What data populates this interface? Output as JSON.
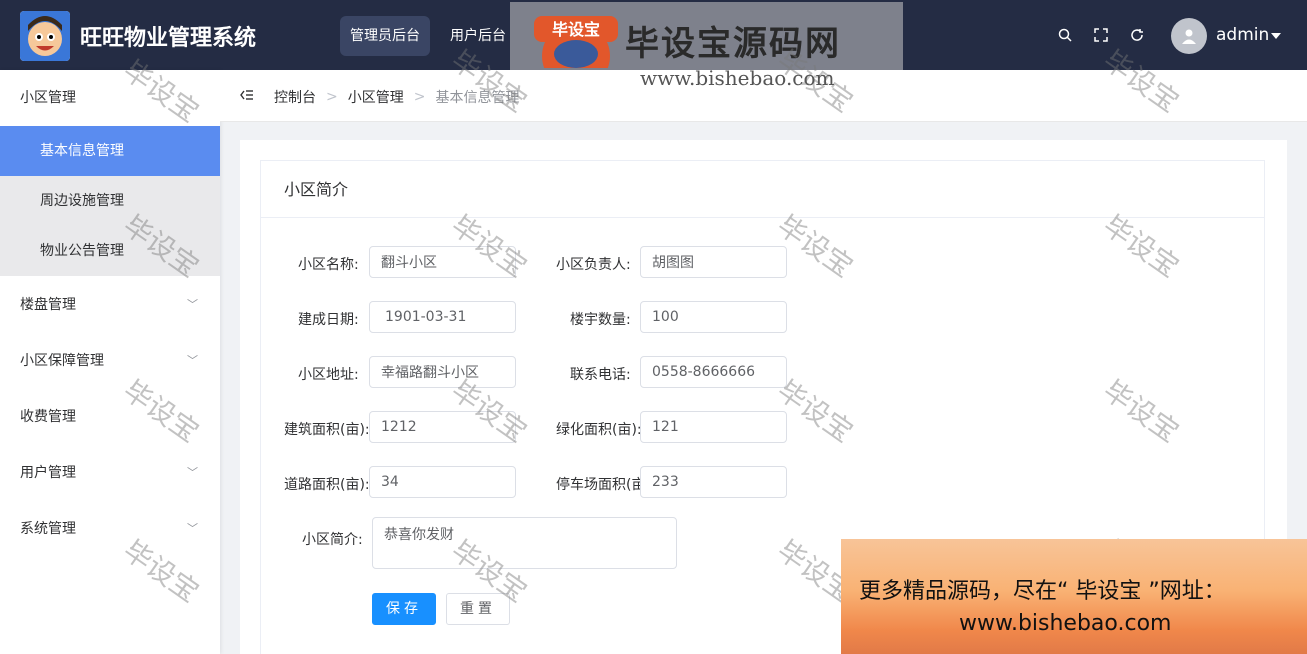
{
  "app": {
    "title": "旺旺物业管理系统"
  },
  "topnav": [
    {
      "label": "管理员后台",
      "active": true
    },
    {
      "label": "用户后台",
      "active": false
    }
  ],
  "watermark_banner": {
    "logo_text": "毕设宝",
    "title": "毕设宝源码网",
    "url": "www.bishebao.com"
  },
  "header": {
    "icons": [
      "search-icon",
      "fullscreen-icon",
      "refresh-icon"
    ],
    "username": "admin"
  },
  "sidebar": {
    "groups": [
      {
        "label": "小区管理",
        "expanded": true,
        "children": [
          {
            "label": "基本信息管理",
            "active": true
          },
          {
            "label": "周边设施管理",
            "active": false
          },
          {
            "label": "物业公告管理",
            "active": false
          }
        ]
      },
      {
        "label": "楼盘管理",
        "has_arrow": true
      },
      {
        "label": "小区保障管理",
        "has_arrow": true
      },
      {
        "label": "收费管理",
        "has_arrow": false
      },
      {
        "label": "用户管理",
        "has_arrow": true
      },
      {
        "label": "系统管理",
        "has_arrow": true
      }
    ]
  },
  "breadcrumb": [
    "控制台",
    "小区管理",
    "基本信息管理"
  ],
  "panel": {
    "title": "小区简介"
  },
  "form": {
    "name_label": "小区名称:",
    "name_value": "翻斗小区",
    "manager_label": "小区负责人:",
    "manager_value": "胡图图",
    "build_date_label": "建成日期:",
    "build_date_value": "1901-03-31",
    "building_count_label": "楼宇数量:",
    "building_count_value": "100",
    "address_label": "小区地址:",
    "address_value": "幸福路翻斗小区",
    "phone_label": "联系电话:",
    "phone_value": "0558-8666666",
    "building_area_label": "建筑面积(亩):",
    "building_area_value": "1212",
    "green_area_label": "绿化面积(亩):",
    "green_area_value": "121",
    "road_area_label": "道路面积(亩):",
    "road_area_value": "34",
    "parking_area_label": "停车场面积(亩",
    "parking_area_value": "233",
    "intro_label": "小区简介:",
    "intro_value": "恭喜你发财",
    "save_label": "保存",
    "reset_label": "重置"
  },
  "watermark_text": "毕设宝",
  "promo": {
    "line1": "更多精品源码，尽在“ 毕设宝 ”网址：",
    "line2": "www.bishebao.com"
  }
}
